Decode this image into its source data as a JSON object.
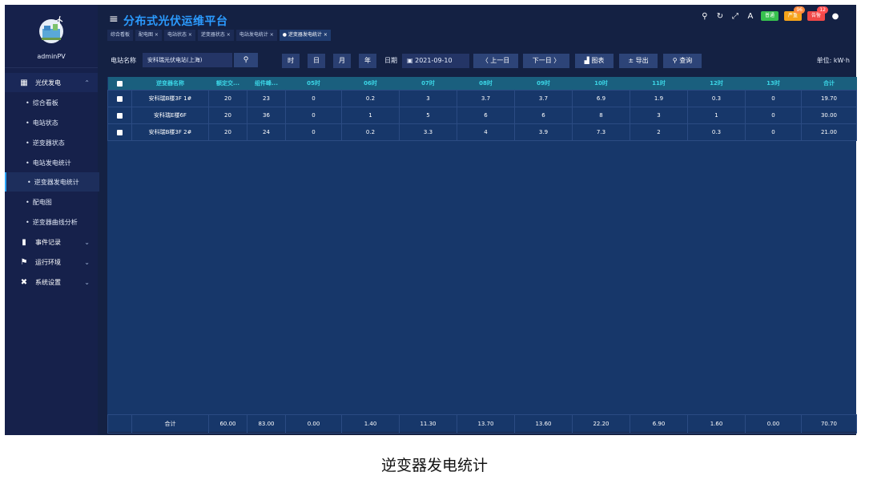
{
  "header": {
    "title": "分布式光伏运维平台",
    "badges": [
      {
        "label": "普通",
        "color": "#37c14e",
        "count": ""
      },
      {
        "label": "严重",
        "color": "#f5a31a",
        "count": "96"
      },
      {
        "label": "告警",
        "color": "#f04848",
        "count": "12"
      }
    ]
  },
  "sidebar": {
    "username": "adminPV",
    "groups": [
      {
        "label": "光伏发电",
        "icon": "grid-icon"
      },
      {
        "label": "事件记录",
        "icon": "event-icon"
      },
      {
        "label": "运行环境",
        "icon": "environment-icon"
      },
      {
        "label": "系统设置",
        "icon": "settings-icon"
      }
    ],
    "items": [
      {
        "label": "综合看板"
      },
      {
        "label": "电站状态"
      },
      {
        "label": "逆变器状态"
      },
      {
        "label": "电站发电统计"
      },
      {
        "label": "逆变器发电统计"
      },
      {
        "label": "配电图"
      },
      {
        "label": "逆变器曲线分析"
      }
    ]
  },
  "tabs": [
    {
      "label": "综合看板"
    },
    {
      "label": "配电图 ×"
    },
    {
      "label": "电站状态 ×"
    },
    {
      "label": "逆变器状态 ×"
    },
    {
      "label": "电站发电统计 ×"
    },
    {
      "label": "● 逆变器发电统计 ×"
    }
  ],
  "toolbar": {
    "station_label": "电站名称",
    "station_value": "安科瑞光伏电站(上海)",
    "periods": [
      "时",
      "日",
      "月",
      "年"
    ],
    "date_label": "日期",
    "date_value": "2021-09-10",
    "prev_label": "〈 上一日",
    "next_label": "下一日 〉",
    "chart_label": "图表",
    "export_label": "导出",
    "query_label": "查询",
    "unit_label": "单位: kW·h"
  },
  "table": {
    "columns": [
      "逆变器名称",
      "额定交...",
      "组件峰...",
      "05时",
      "06时",
      "07时",
      "08时",
      "09时",
      "10时",
      "11时",
      "12时",
      "13时",
      "合计"
    ],
    "rows": [
      [
        "安科瑞B楼3F 1#",
        "20",
        "23",
        "0",
        "0.2",
        "3",
        "3.7",
        "3.7",
        "6.9",
        "1.9",
        "0.3",
        "0",
        "19.70"
      ],
      [
        "安科瑞E楼6F",
        "20",
        "36",
        "0",
        "1",
        "5",
        "6",
        "6",
        "8",
        "3",
        "1",
        "0",
        "30.00"
      ],
      [
        "安科瑞B楼3F 2#",
        "20",
        "24",
        "0",
        "0.2",
        "3.3",
        "4",
        "3.9",
        "7.3",
        "2",
        "0.3",
        "0",
        "21.00"
      ]
    ],
    "footer": [
      "合计",
      "60.00",
      "83.00",
      "0.00",
      "1.40",
      "11.30",
      "13.70",
      "13.60",
      "22.20",
      "6.90",
      "1.60",
      "0.00",
      "70.70"
    ]
  },
  "caption": "逆变器发电统计"
}
